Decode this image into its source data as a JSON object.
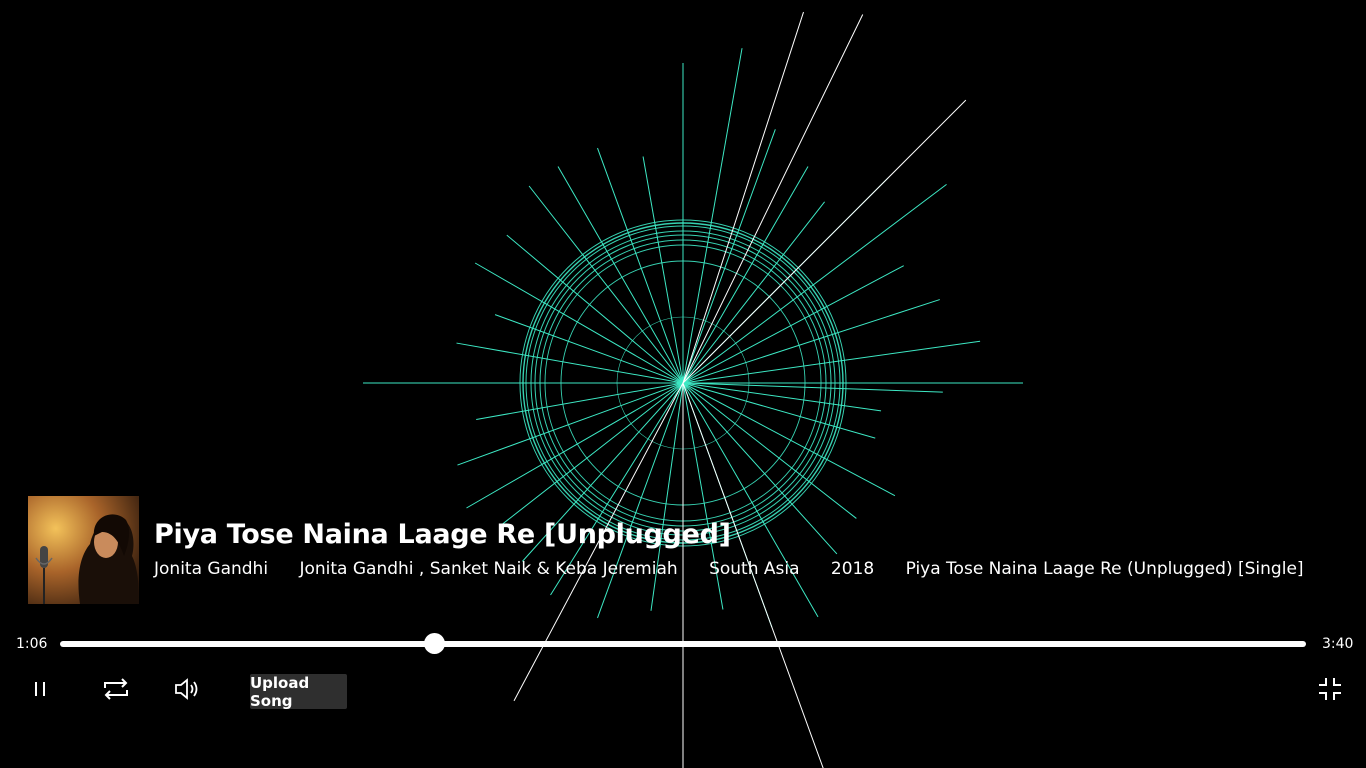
{
  "player": {
    "title": "Piya Tose Naina Laage Re [Unplugged]",
    "meta": {
      "artist": "Jonita Gandhi",
      "performers": "Jonita Gandhi , Sanket Naik & Keba Jeremiah",
      "region": "South Asia",
      "year": "2018",
      "album": "Piya Tose Naina Laage Re (Unplugged) [Single]"
    },
    "current_time": "1:06",
    "total_time": "3:40",
    "progress_fraction": 0.3
  },
  "controls": {
    "pause_icon": "pause-icon",
    "repeat_icon": "repeat-icon",
    "volume_icon": "volume-icon",
    "upload_label": "Upload Song",
    "exit_fullscreen_icon": "exit-fullscreen-icon"
  },
  "colors": {
    "visualizer_accent": "#3de8c4",
    "background": "#000000",
    "upload_button_bg": "#2f2f2f"
  }
}
